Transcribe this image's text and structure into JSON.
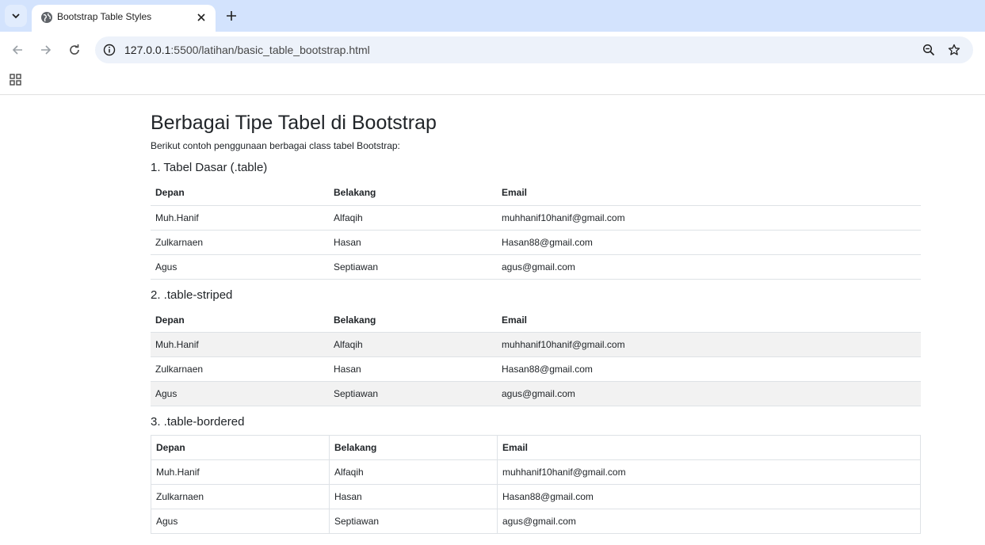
{
  "browser": {
    "tab_title": "Bootstrap Table Styles",
    "url_host": "127.0.0.1",
    "url_path": ":5500/latihan/basic_table_bootstrap.html"
  },
  "page": {
    "title": "Berbagai Tipe Tabel di Bootstrap",
    "intro": "Berikut contoh penggunaan berbagai class tabel Bootstrap:"
  },
  "tables": [
    {
      "heading": "1. Tabel Dasar (.table)",
      "headers": [
        "Depan",
        "Belakang",
        "Email"
      ],
      "rows": [
        [
          "Muh.Hanif",
          "Alfaqih",
          "muhhanif10hanif@gmail.com"
        ],
        [
          "Zulkarnaen",
          "Hasan",
          "Hasan88@gmail.com"
        ],
        [
          "Agus",
          "Septiawan",
          "agus@gmail.com"
        ]
      ]
    },
    {
      "heading": "2. .table-striped",
      "headers": [
        "Depan",
        "Belakang",
        "Email"
      ],
      "rows": [
        [
          "Muh.Hanif",
          "Alfaqih",
          "muhhanif10hanif@gmail.com"
        ],
        [
          "Zulkarnaen",
          "Hasan",
          "Hasan88@gmail.com"
        ],
        [
          "Agus",
          "Septiawan",
          "agus@gmail.com"
        ]
      ]
    },
    {
      "heading": "3. .table-bordered",
      "headers": [
        "Depan",
        "Belakang",
        "Email"
      ],
      "rows": [
        [
          "Muh.Hanif",
          "Alfaqih",
          "muhhanif10hanif@gmail.com"
        ],
        [
          "Zulkarnaen",
          "Hasan",
          "Hasan88@gmail.com"
        ],
        [
          "Agus",
          "Septiawan",
          "agus@gmail.com"
        ]
      ]
    }
  ]
}
